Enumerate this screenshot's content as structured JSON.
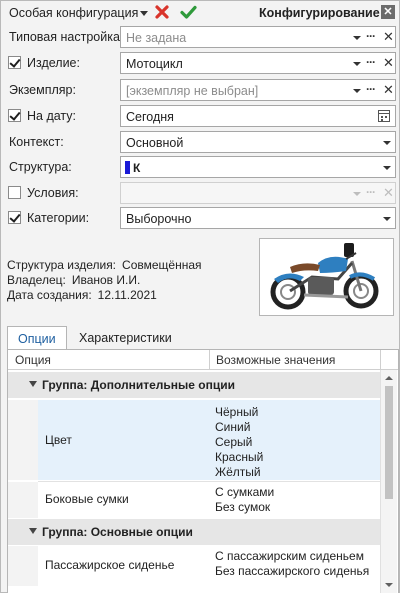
{
  "header": {
    "config_name": "Особая конфигурация",
    "panel_title": "Конфигурирование",
    "close_glyph": "✕"
  },
  "form": {
    "typical_label": "Типовая настройка:",
    "typical_value": "Не задана",
    "product_label": "Изделие:",
    "product_value": "Мотоцикл",
    "instance_label": "Экземпляр:",
    "instance_value": "[экземпляр не выбран]",
    "date_label": "На дату:",
    "date_value": "Сегодня",
    "context_label": "Контекст:",
    "context_value": "Основной",
    "structure_label": "Структура:",
    "structure_value": "К",
    "conditions_label": "Условия:",
    "conditions_value": "",
    "categories_label": "Категории:",
    "categories_value": "Выборочно"
  },
  "info": {
    "structure_label": "Структура изделия:",
    "structure_value": "Совмещённая",
    "owner_label": "Владелец:",
    "owner_value": "Иванов И.И.",
    "created_label": "Дата создания:",
    "created_value": "12.11.2021"
  },
  "tabs": {
    "options": "Опции",
    "characteristics": "Характеристики"
  },
  "grid": {
    "col_option": "Опция",
    "col_values": "Возможные значения",
    "group1": "Группа: Дополнительные опции",
    "color_name": "Цвет",
    "color_values": [
      "Чёрный",
      "Синий",
      "Серый",
      "Красный",
      "Жёлтый"
    ],
    "bags_name": "Боковые сумки",
    "bags_values": [
      "С сумками",
      "Без сумок"
    ],
    "group2": "Группа: Основные опции",
    "seat_name": "Пассажирское сиденье",
    "seat_values": [
      "С пассажирским сиденьем",
      "Без пассажирского сиденья"
    ]
  },
  "colors": {
    "accent_red": "#d9342b",
    "accent_green": "#2f9a3b",
    "selection": "#e5f1fb",
    "structure_mark": "#1a1ad6"
  }
}
